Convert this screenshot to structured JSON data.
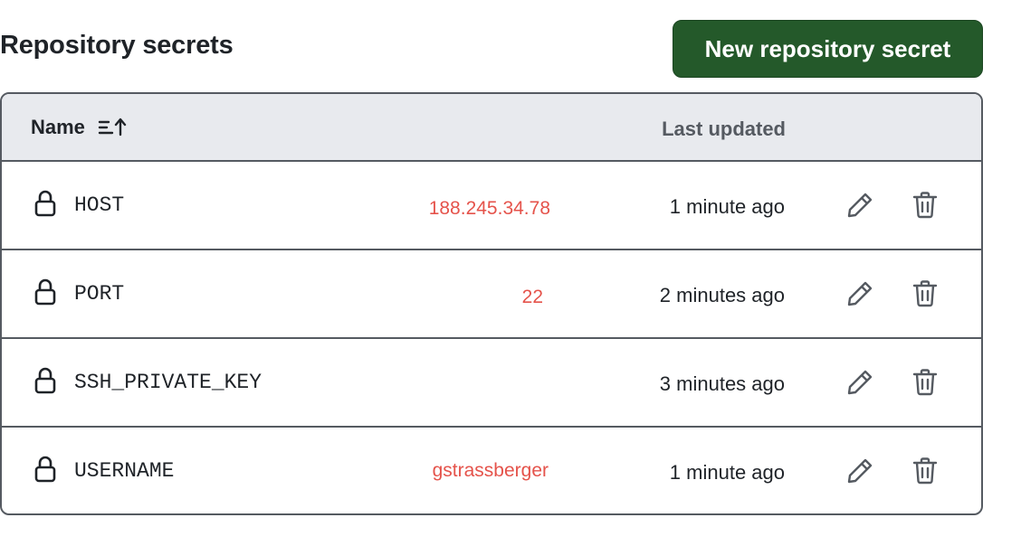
{
  "header": {
    "title": "Repository secrets",
    "new_button_label": "New repository secret"
  },
  "table": {
    "columns": {
      "name": "Name",
      "last_updated": "Last updated"
    },
    "rows": [
      {
        "name": "HOST",
        "value": "188.245.34.78",
        "updated": "1 minute ago"
      },
      {
        "name": "PORT",
        "value": "22",
        "updated": "2 minutes ago"
      },
      {
        "name": "SSH_PRIVATE_KEY",
        "value": "",
        "updated": "3 minutes ago"
      },
      {
        "name": "USERNAME",
        "value": "gstrassberger",
        "updated": "1 minute ago"
      }
    ]
  },
  "icons": {
    "sort": "sort-ascending-icon",
    "lock": "lock-icon",
    "edit": "pencil-icon",
    "delete": "trash-icon"
  },
  "colors": {
    "primary_button": "#24592a",
    "annotation_text": "#e5534b",
    "header_bg": "#e8eaee"
  }
}
